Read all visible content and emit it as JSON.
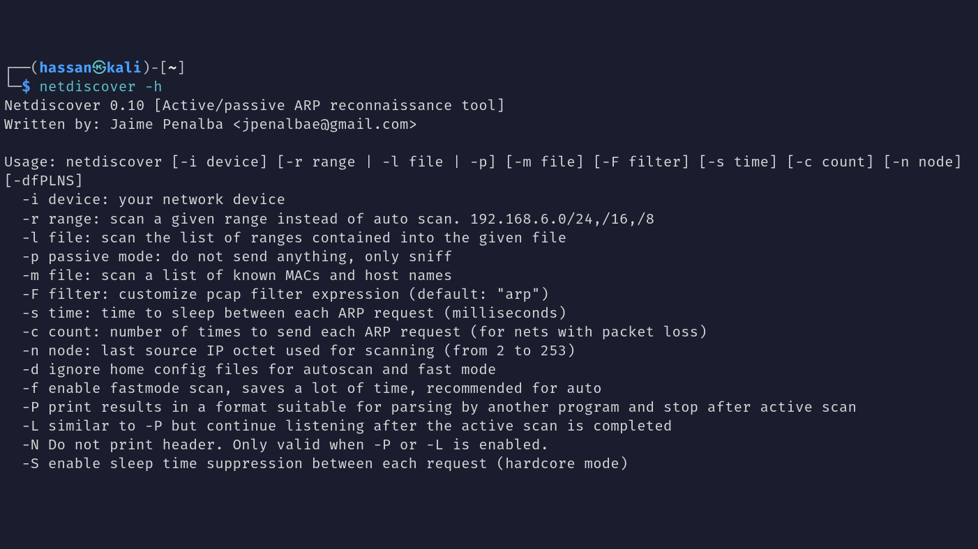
{
  "prompt": {
    "user": "hassan",
    "host": "kali",
    "path": "~",
    "symbol": "$",
    "command": "netdiscover -h"
  },
  "output": {
    "title": "Netdiscover 0.10 [Active/passive ARP reconnaissance tool]",
    "author": "Written by: Jaime Penalba <jpenalbae@gmail.com>",
    "usage": "Usage: netdiscover [-i device] [-r range | -l file | -p] [-m file] [-F filter] [-s time] [-c count] [-n node] [-dfPLNS]",
    "options": [
      "  -i device: your network device",
      "  -r range: scan a given range instead of auto scan. 192.168.6.0/24,/16,/8",
      "  -l file: scan the list of ranges contained into the given file",
      "  -p passive mode: do not send anything, only sniff",
      "  -m file: scan a list of known MACs and host names",
      "  -F filter: customize pcap filter expression (default: \"arp\")",
      "  -s time: time to sleep between each ARP request (milliseconds)",
      "  -c count: number of times to send each ARP request (for nets with packet loss)",
      "  -n node: last source IP octet used for scanning (from 2 to 253)",
      "  -d ignore home config files for autoscan and fast mode",
      "  -f enable fastmode scan, saves a lot of time, recommended for auto",
      "  -P print results in a format suitable for parsing by another program and stop after active scan",
      "  -L similar to -P but continue listening after the active scan is completed",
      "  -N Do not print header. Only valid when -P or -L is enabled.",
      "  -S enable sleep time suppression between each request (hardcore mode)"
    ]
  }
}
